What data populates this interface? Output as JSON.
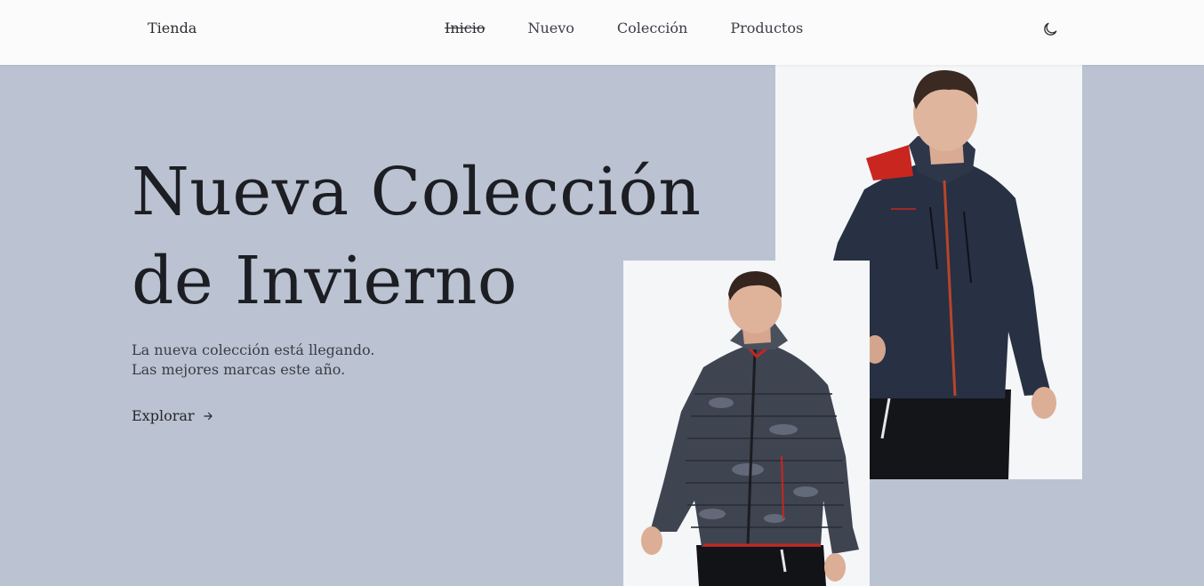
{
  "header": {
    "logo": "Tienda",
    "nav": [
      {
        "label": "Inicio",
        "active": true
      },
      {
        "label": "Nuevo",
        "active": false
      },
      {
        "label": "Colección",
        "active": false
      },
      {
        "label": "Productos",
        "active": false
      }
    ],
    "theme_icon": "moon-icon"
  },
  "hero": {
    "title_line1": "Nueva Colección",
    "title_line2": "de Invierno",
    "desc_line1": "La nueva colección está llegando.",
    "desc_line2": "Las mejores marcas este año.",
    "cta_label": "Explorar",
    "cta_icon": "arrow-right-icon"
  },
  "images": {
    "back": "man-navy-jacket-photo",
    "front": "man-camo-puffer-jacket-photo"
  },
  "colors": {
    "hero_bg": "#bbc3d2",
    "header_bg": "#fbfbfb",
    "text": "#1c1e23",
    "photo_bg": "#f4f6f8",
    "jacket_navy": "#283043",
    "jacket_accent_red": "#c8261f"
  }
}
